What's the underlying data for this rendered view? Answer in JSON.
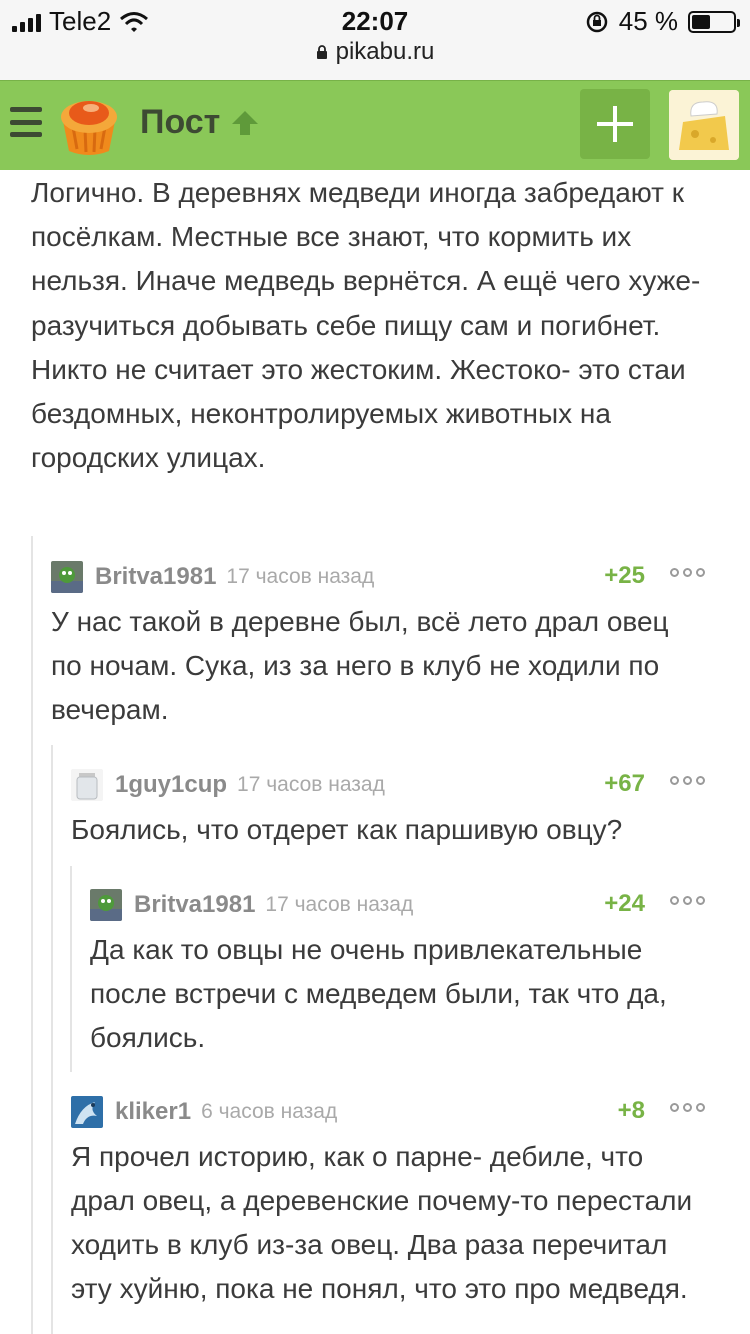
{
  "status_bar": {
    "carrier": "Tele2",
    "time": "22:07",
    "battery_text": "45 %",
    "battery_level": 0.45,
    "url": "pikabu.ru"
  },
  "navbar": {
    "title": "Пост",
    "icons": [
      "menu-icon",
      "pikabu-logo",
      "arrow-up-icon",
      "plus-icon",
      "user-avatar"
    ],
    "accent_color": "#8ac858"
  },
  "post": {
    "paragraphs": [
      "Логично. В деревнях медведи иногда забредают к посёлкам. Местные все знают, что кормить их нельзя. Иначе медведь вернётся. А ещё чего хуже- разучиться добывать себе пищу сам и погибнет.",
      "Никто не считает это жестоким. Жестоко- это стаи бездомных, неконтролируемых животных на городских улицах."
    ]
  },
  "comments": [
    {
      "user": "Britva1981",
      "time": "17 часов назад",
      "rating": "+25",
      "text": "У нас такой в деревне был, всё лето драл овец по ночам. Сука, из за него в клуб не ходили по вечерам."
    },
    {
      "user": "1guy1cup",
      "time": "17 часов назад",
      "rating": "+67",
      "text": "Боялись, что отдерет как паршивую овцу?"
    },
    {
      "user": "Britva1981",
      "time": "17 часов назад",
      "rating": "+24",
      "text": "Да как то овцы не очень привлекательные после встречи с медведем были, так что да, боялись."
    },
    {
      "user": "kliker1",
      "time": "6 часов назад",
      "rating": "+8",
      "text": "Я прочел историю, как о парне- дебиле, что драл овец, а деревенские почему-то перестали ходить в клуб из-за овец. Два раза перечитал эту хуйню, пока не понял, что это про медведя."
    }
  ]
}
